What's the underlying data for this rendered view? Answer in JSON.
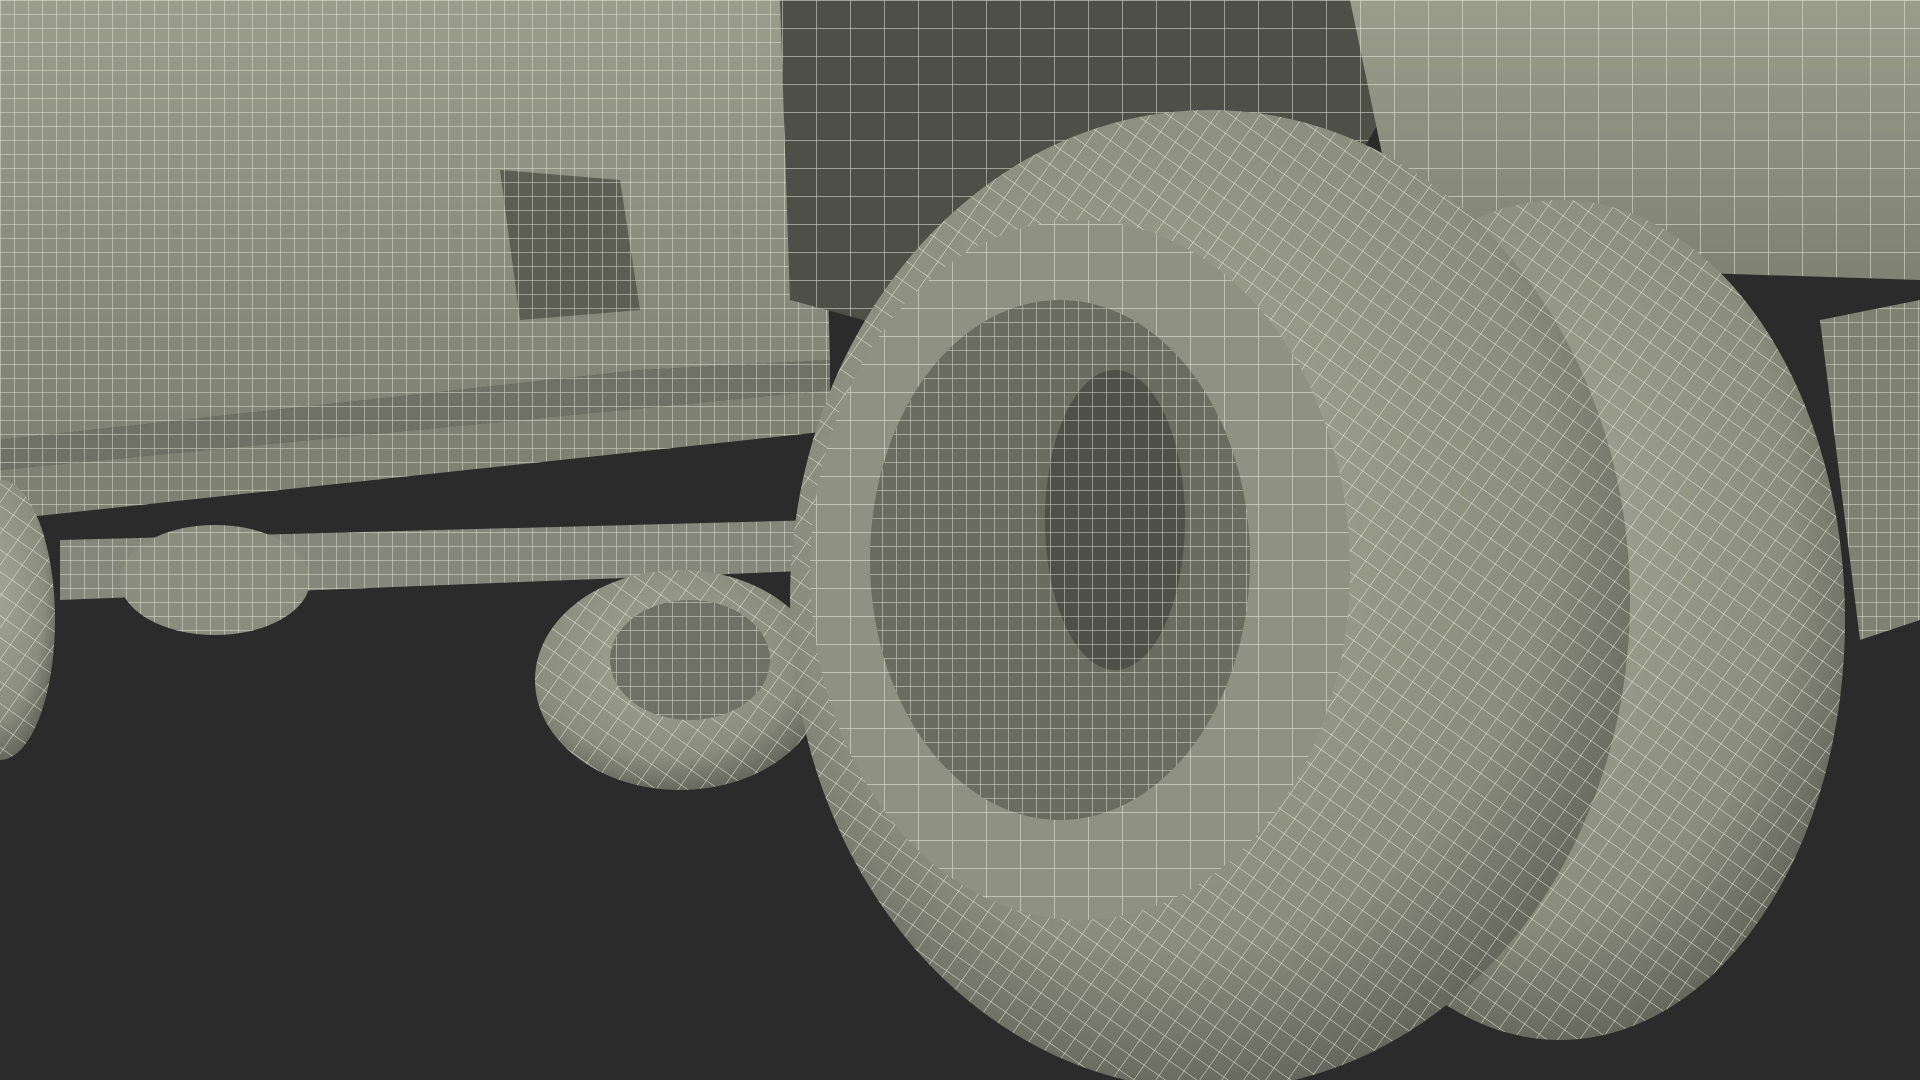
{
  "viewport": {
    "background_color": "#2b2b2b"
  },
  "render": {
    "mode": "wireframe-on-shaded",
    "surface_color": "#8a8c7d",
    "surface_shadow_color": "#4e5047",
    "surface_highlight_color": "#a3a595",
    "wire_color": "#f1f1e4"
  }
}
